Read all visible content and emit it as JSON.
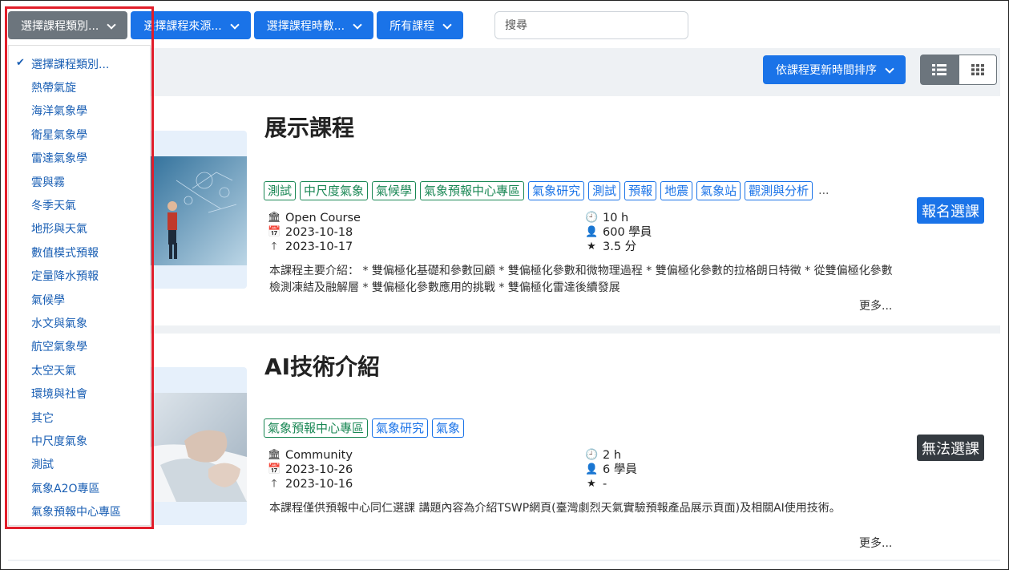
{
  "filters": {
    "category_label": "選擇課程類別...",
    "source_label": "選擇課程來源...",
    "hours_label": "選擇課程時數...",
    "all_label": "所有課程",
    "search_placeholder": "搜尋"
  },
  "sort": {
    "label": "依課程更新時間排序"
  },
  "category_menu": {
    "items": [
      "選擇課程類別...",
      "熱帶氣旋",
      "海洋氣象學",
      "衛星氣象學",
      "雷達氣象學",
      "雲與霧",
      "冬季天氣",
      "地形與天氣",
      "數值模式預報",
      "定量降水預報",
      "氣候學",
      "水文與氣象",
      "航空氣象學",
      "太空天氣",
      "環境與社會",
      "其它",
      "中尺度氣象",
      "測試",
      "氣象A2O專區",
      "氣象預報中心專區"
    ],
    "selected_index": 0
  },
  "courses": [
    {
      "title": "展示課程",
      "tags": [
        {
          "text": "測試",
          "color": "green"
        },
        {
          "text": "中尺度氣象",
          "color": "green"
        },
        {
          "text": "氣候學",
          "color": "green"
        },
        {
          "text": "氣象預報中心專區",
          "color": "green"
        },
        {
          "text": "氣象研究",
          "color": "blue"
        },
        {
          "text": "測試",
          "color": "blue"
        },
        {
          "text": "預報",
          "color": "blue"
        },
        {
          "text": "地震",
          "color": "blue"
        },
        {
          "text": "氣象站",
          "color": "blue"
        },
        {
          "text": "觀測與分析",
          "color": "blue"
        }
      ],
      "tags_more": "...",
      "source": "Open Course",
      "date_created": "2023-10-18",
      "date_updated": "2023-10-17",
      "hours": "10 h",
      "students": "600 學員",
      "rating": "3.5 分",
      "description": "本課程主要介紹： * 雙偏極化基礎和參數回顧 * 雙偏極化參數和微物理過程 * 雙偏極化參數的拉格朗日特徵 * 從雙偏極化參數檢測凍結及融解層 * 雙偏極化參數應用的挑戰 * 雙偏極化雷達後續發展",
      "more": "更多...",
      "action": "報名選課"
    },
    {
      "title": "AI技術介紹",
      "tags": [
        {
          "text": "氣象預報中心專區",
          "color": "green"
        },
        {
          "text": "氣象研究",
          "color": "blue"
        },
        {
          "text": "氣象",
          "color": "blue"
        }
      ],
      "source": "Community",
      "date_created": "2023-10-26",
      "date_updated": "2023-10-16",
      "hours": "2 h",
      "students": "6 學員",
      "rating": "-",
      "description": "本課程僅供預報中心同仁選課 講題內容為介紹TSWP網頁(臺灣劇烈天氣實驗預報產品展示頁面)及相關AI使用技術。",
      "more": "更多...",
      "action": "無法選課"
    }
  ],
  "colors": {
    "primary": "#1a73e8",
    "secondary": "#6c757d",
    "tag_green": "#198754",
    "highlight_box": "#e11d2a"
  },
  "icons": [
    "chevron-down-icon",
    "list-view-icon",
    "grid-view-icon",
    "institution-icon",
    "calendar-icon",
    "arrow-up-icon",
    "clock-icon",
    "user-icon",
    "star-icon",
    "check-icon"
  ]
}
